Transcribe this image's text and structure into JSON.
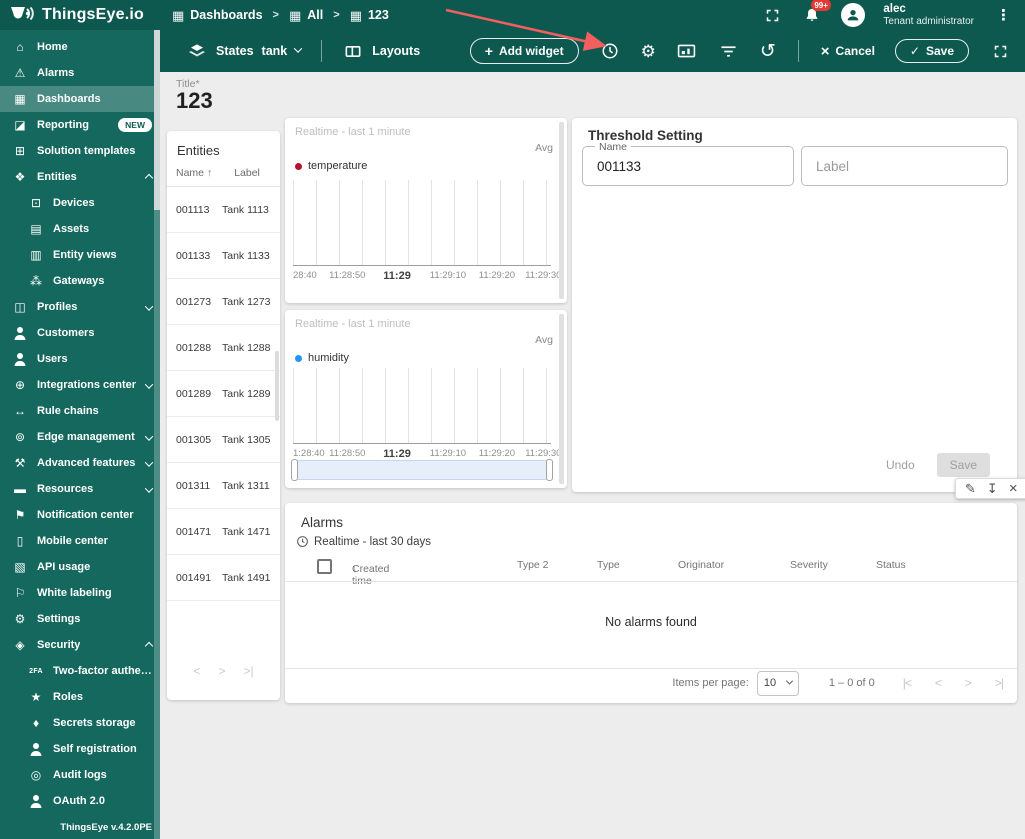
{
  "topbar": {
    "brand": "ThingsEye.io",
    "breadcrumb": [
      {
        "label": "Dashboards"
      },
      {
        "label": "All"
      },
      {
        "label": "123"
      }
    ],
    "notifications_badge": "99+",
    "user": {
      "name": "alec",
      "role": "Tenant administrator"
    }
  },
  "dash_toolbar": {
    "states_label": "States",
    "state_value": "tank",
    "layouts_label": "Layouts",
    "add_widget_label": "Add widget",
    "cancel_label": "Cancel",
    "save_label": "Save"
  },
  "title_field": {
    "label": "Title*",
    "value": "123"
  },
  "sidebar": {
    "footer": "ThingsEye v.4.2.0PE",
    "items": [
      {
        "label": "Home",
        "glyph": "⌂"
      },
      {
        "label": "Alarms",
        "glyph": "⚠"
      },
      {
        "label": "Dashboards",
        "glyph": "▦",
        "selected": true
      },
      {
        "label": "Reporting",
        "glyph": "◪",
        "badge": "NEW"
      },
      {
        "label": "Solution templates",
        "glyph": "⊞"
      },
      {
        "label": "Entities",
        "glyph": "❖",
        "expanded": true
      },
      {
        "label": "Devices",
        "glyph": "⊡",
        "child": true
      },
      {
        "label": "Assets",
        "glyph": "▤",
        "child": true
      },
      {
        "label": "Entity views",
        "glyph": "▥",
        "child": true
      },
      {
        "label": "Gateways",
        "glyph": "⁂",
        "child": true
      },
      {
        "label": "Profiles",
        "glyph": "◫",
        "collapsed": true
      },
      {
        "label": "Customers",
        "glyph": "person"
      },
      {
        "label": "Users",
        "glyph": "person"
      },
      {
        "label": "Integrations center",
        "glyph": "⊕",
        "collapsed": true
      },
      {
        "label": "Rule chains",
        "glyph": "↔"
      },
      {
        "label": "Edge management",
        "glyph": "⊚",
        "collapsed": true
      },
      {
        "label": "Advanced features",
        "glyph": "⚒",
        "collapsed": true
      },
      {
        "label": "Resources",
        "glyph": "▬",
        "collapsed": true
      },
      {
        "label": "Notification center",
        "glyph": "⚑"
      },
      {
        "label": "Mobile center",
        "glyph": "▯"
      },
      {
        "label": "API usage",
        "glyph": "▧"
      },
      {
        "label": "White labeling",
        "glyph": "⚐"
      },
      {
        "label": "Settings",
        "glyph": "⚙"
      },
      {
        "label": "Security",
        "glyph": "◈",
        "expanded": true
      },
      {
        "label": "Two-factor authenticati...",
        "glyph": "2FA",
        "child": true
      },
      {
        "label": "Roles",
        "glyph": "★",
        "child": true
      },
      {
        "label": "Secrets storage",
        "glyph": "♦",
        "child": true
      },
      {
        "label": "Self registration",
        "glyph": "person",
        "child": true
      },
      {
        "label": "Audit logs",
        "glyph": "◎",
        "child": true
      },
      {
        "label": "OAuth 2.0",
        "glyph": "person",
        "child": true
      }
    ]
  },
  "entities_widget": {
    "title": "Entities",
    "columns": {
      "name": "Name",
      "label": "Label"
    },
    "sort_icon": "↑",
    "rows": [
      {
        "name": "001113",
        "label": "Tank 1113"
      },
      {
        "name": "001133",
        "label": "Tank 1133"
      },
      {
        "name": "001273",
        "label": "Tank 1273"
      },
      {
        "name": "001288",
        "label": "Tank 1288"
      },
      {
        "name": "001289",
        "label": "Tank 1289"
      },
      {
        "name": "001305",
        "label": "Tank 1305"
      },
      {
        "name": "001311",
        "label": "Tank 1311"
      },
      {
        "name": "001471",
        "label": "Tank 1471"
      },
      {
        "name": "001491",
        "label": "Tank 1491"
      }
    ],
    "pager_icons": {
      "prev": "<",
      "next": ">",
      "last": ">|"
    }
  },
  "chart_data": [
    {
      "type": "line",
      "title": "Realtime - last 1 minute",
      "aggregation": "Avg",
      "series": [
        {
          "name": "temperature",
          "color": "#b5122e",
          "values": []
        }
      ],
      "x_ticks": [
        "28:40",
        "11:28:50",
        "11:29",
        "11:29:10",
        "11:29:20",
        "11:29:30"
      ],
      "grid": true,
      "legend_position": "top-left",
      "ylim": null
    },
    {
      "type": "line",
      "title": "Realtime - last 1 minute",
      "aggregation": "Avg",
      "series": [
        {
          "name": "humidity",
          "color": "#2196f3",
          "values": []
        }
      ],
      "x_ticks": [
        "1:28:40",
        "11:28:50",
        "11:29",
        "11:29:10",
        "11:29:20",
        "11:29:30"
      ],
      "grid": true,
      "legend_position": "top-left",
      "has_datazoom_slider": true,
      "ylim": null
    }
  ],
  "threshold_widget": {
    "title": "Threshold Setting",
    "name_field": {
      "label": "Name",
      "value": "001133"
    },
    "label_field": {
      "placeholder": "Label"
    },
    "undo_label": "Undo",
    "save_label": "Save"
  },
  "alarms_widget": {
    "title": "Alarms",
    "subtitle": "Realtime - last 30 days",
    "columns": [
      "Created time",
      "Type 2",
      "Type",
      "Originator",
      "Severity",
      "Status"
    ],
    "sort_icon": "↓",
    "empty_text": "No alarms found",
    "items_per_page_label": "Items per page:",
    "items_per_page_value": "10",
    "range_text": "1 – 0 of 0",
    "pager_icons": {
      "first": "|<",
      "prev": "<",
      "next": ">",
      "last": ">|"
    }
  },
  "icons": {
    "gear": "⚙",
    "history": "↺",
    "kebab": "⋮",
    "pencil": "✎",
    "download": "↧",
    "close": "×",
    "check": "✓",
    "plus": "+",
    "crumb_grid": "▦",
    "crumb_sep": ">"
  },
  "colors": {
    "topbar": "#0d5950",
    "sidebar": "#15685e",
    "content_bg": "#ededed",
    "temperature_series": "#b5122e",
    "humidity_series": "#2196f3",
    "notification_badge": "#e53935",
    "annotation_arrow": "#f25f5f"
  }
}
